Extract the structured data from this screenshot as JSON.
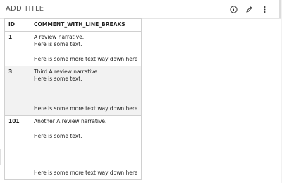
{
  "header": {
    "title": "ADD TITLE",
    "icons": [
      "info-icon",
      "edit-pencil-icon",
      "more-vertical-icon"
    ]
  },
  "table": {
    "columns": [
      "ID",
      "COMMENT_WITH_LINE_BREAKS"
    ],
    "rows": [
      {
        "id": "1",
        "lines": [
          "A review narrative.",
          "Here is some text.",
          "",
          "Here is some more text way down here"
        ]
      },
      {
        "id": "3",
        "lines": [
          "Third A review narrative.",
          "Here is some text.",
          "",
          "",
          "",
          "Here is some more text way down here"
        ]
      },
      {
        "id": "101",
        "lines": [
          "Another A review narrative.",
          "",
          "Here is some text.",
          "",
          "",
          "",
          "",
          "Here is some more text way down here"
        ]
      }
    ]
  }
}
